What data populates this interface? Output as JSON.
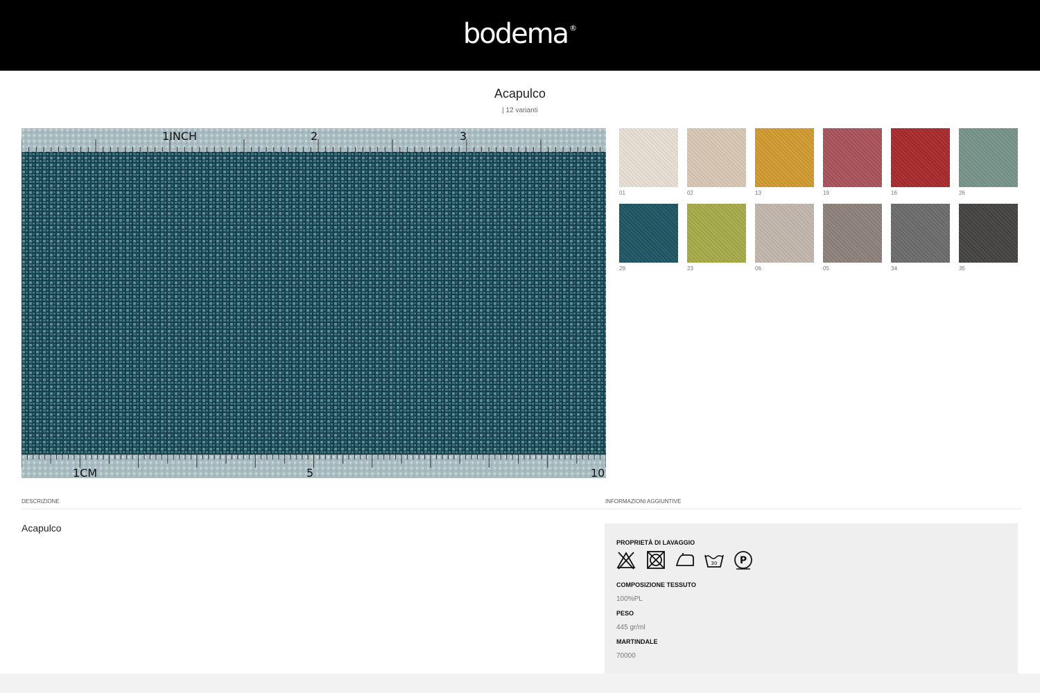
{
  "header": {
    "logo_text": "bodema",
    "logo_mark": "®"
  },
  "product": {
    "name": "Acapulco",
    "variants_label": "| 12 varianti"
  },
  "main_swatch": {
    "color": "#1f5563",
    "ruler_top_labels": [
      "1INCH",
      "2",
      "3"
    ],
    "ruler_bottom_labels": [
      "1CM",
      "5",
      "10"
    ]
  },
  "variants": [
    {
      "code": "01",
      "color": "#e8dfd3"
    },
    {
      "code": "02",
      "color": "#d9c7b4"
    },
    {
      "code": "13",
      "color": "#d19a2f"
    },
    {
      "code": "19",
      "color": "#a9535b"
    },
    {
      "code": "16",
      "color": "#a82a2b"
    },
    {
      "code": "26",
      "color": "#76938a"
    },
    {
      "code": "29",
      "color": "#1f5563"
    },
    {
      "code": "23",
      "color": "#a6ab4a"
    },
    {
      "code": "06",
      "color": "#c2b7ad"
    },
    {
      "code": "05",
      "color": "#8d827b"
    },
    {
      "code": "34",
      "color": "#6b6b6b"
    },
    {
      "code": "35",
      "color": "#454341"
    }
  ],
  "sections": {
    "description_label": "DESCRIZIONE",
    "info_label": "INFORMAZIONI AGGIUNTIVE"
  },
  "description": {
    "text": "Acapulco"
  },
  "info": {
    "washing_heading": "PROPRIETÀ DI LAVAGGIO",
    "care_icons": [
      "no-bleach-icon",
      "no-tumble-dry-icon",
      "iron-icon",
      "wash-30-icon",
      "dry-clean-p-icon"
    ],
    "wash_temp": "30",
    "dry_clean_letter": "P",
    "composition_heading": "COMPOSIZIONE TESSUTO",
    "composition_value": "100%PL",
    "weight_heading": "PESO",
    "weight_value": "445 gr/ml",
    "martindale_heading": "MARTINDALE",
    "martindale_value": "70000"
  }
}
